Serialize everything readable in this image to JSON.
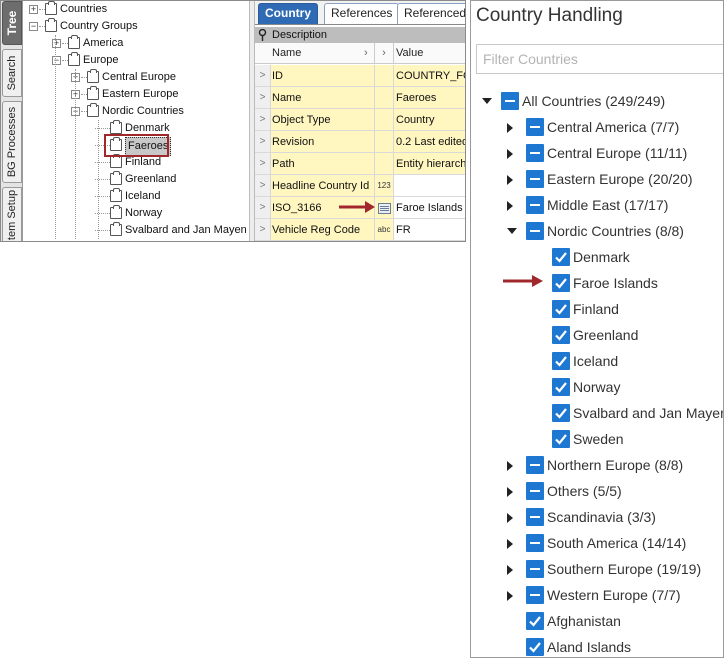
{
  "left_tabs": [
    "Tree",
    "Search",
    "BG Processes",
    "tem Setup"
  ],
  "tree": [
    {
      "label": "Countries",
      "level": 1,
      "expander": "+"
    },
    {
      "label": "Country Groups",
      "level": 1,
      "expander": "-"
    },
    {
      "label": "America",
      "level": 2,
      "expander": "+"
    },
    {
      "label": "Europe",
      "level": 2,
      "expander": "-"
    },
    {
      "label": "Central Europe",
      "level": 3,
      "expander": "+"
    },
    {
      "label": "Eastern Europe",
      "level": 3,
      "expander": "+"
    },
    {
      "label": "Nordic Countries",
      "level": 3,
      "expander": "-"
    },
    {
      "label": "Denmark",
      "level": 4
    },
    {
      "label": "Faeroes",
      "level": 4,
      "selected": true
    },
    {
      "label": "Finland",
      "level": 4
    },
    {
      "label": "Greenland",
      "level": 4
    },
    {
      "label": "Iceland",
      "level": 4
    },
    {
      "label": "Norway",
      "level": 4
    },
    {
      "label": "Svalbard and Jan Mayen",
      "level": 4
    }
  ],
  "detail_tabs": [
    "Country",
    "References",
    "Referenced"
  ],
  "description_label": "Description",
  "grid_header": {
    "name": "Name",
    "value": "Value"
  },
  "grid_rows": [
    {
      "name": "ID",
      "type": "",
      "value": "COUNTRY_FO"
    },
    {
      "name": "Name",
      "type": "",
      "value": "Faeroes"
    },
    {
      "name": "Object Type",
      "type": "",
      "value": "Country"
    },
    {
      "name": "Revision",
      "type": "",
      "value": "0.2 Last edited"
    },
    {
      "name": "Path",
      "type": "",
      "value": "Entity hierarch"
    },
    {
      "name": "Headline Country Id",
      "type": "123",
      "value": ""
    },
    {
      "name": "ISO_3166",
      "type": "list",
      "value": "Faroe Islands"
    },
    {
      "name": "Vehicle Reg Code",
      "type": "abc",
      "value": "FR"
    }
  ],
  "right_panel": {
    "title": "Country Handling",
    "filter_placeholder": "Filter Countries",
    "items": [
      {
        "label": "All Countries (249/249)",
        "level": 0,
        "caret": "down",
        "state": "indeterminate"
      },
      {
        "label": "Central America (7/7)",
        "level": 1,
        "caret": "right",
        "state": "indeterminate"
      },
      {
        "label": "Central Europe (11/11)",
        "level": 1,
        "caret": "right",
        "state": "indeterminate"
      },
      {
        "label": "Eastern Europe (20/20)",
        "level": 1,
        "caret": "right",
        "state": "indeterminate"
      },
      {
        "label": "Middle East (17/17)",
        "level": 1,
        "caret": "right",
        "state": "indeterminate"
      },
      {
        "label": "Nordic Countries (8/8)",
        "level": 1,
        "caret": "down",
        "state": "indeterminate"
      },
      {
        "label": "Denmark",
        "level": 2,
        "state": "checked"
      },
      {
        "label": "Faroe Islands",
        "level": 2,
        "state": "checked"
      },
      {
        "label": "Finland",
        "level": 2,
        "state": "checked"
      },
      {
        "label": "Greenland",
        "level": 2,
        "state": "checked"
      },
      {
        "label": "Iceland",
        "level": 2,
        "state": "checked"
      },
      {
        "label": "Norway",
        "level": 2,
        "state": "checked"
      },
      {
        "label": "Svalbard and Jan Mayen",
        "level": 2,
        "state": "checked"
      },
      {
        "label": "Sweden",
        "level": 2,
        "state": "checked"
      },
      {
        "label": "Northern Europe (8/8)",
        "level": 1,
        "caret": "right",
        "state": "indeterminate"
      },
      {
        "label": "Others (5/5)",
        "level": 1,
        "caret": "right",
        "state": "indeterminate"
      },
      {
        "label": "Scandinavia (3/3)",
        "level": 1,
        "caret": "right",
        "state": "indeterminate"
      },
      {
        "label": "South America (14/14)",
        "level": 1,
        "caret": "right",
        "state": "indeterminate"
      },
      {
        "label": "Southern Europe (19/19)",
        "level": 1,
        "caret": "right",
        "state": "indeterminate"
      },
      {
        "label": "Western Europe (7/7)",
        "level": 1,
        "caret": "right",
        "state": "indeterminate"
      },
      {
        "label": "Afghanistan",
        "level": 1,
        "state": "checked"
      },
      {
        "label": "Aland Islands",
        "level": 1,
        "state": "checked"
      }
    ]
  },
  "colors": {
    "accent_blue": "#1e78d2",
    "annotation_red": "#a0282c",
    "tab_active": "#2f6bb5",
    "grid_highlight": "#fff6c0"
  },
  "icons": {
    "tree_node": "folder-icon",
    "pin": "pin-icon",
    "annotation": "red-arrow-icon",
    "checkbox": "checkbox-icon"
  }
}
